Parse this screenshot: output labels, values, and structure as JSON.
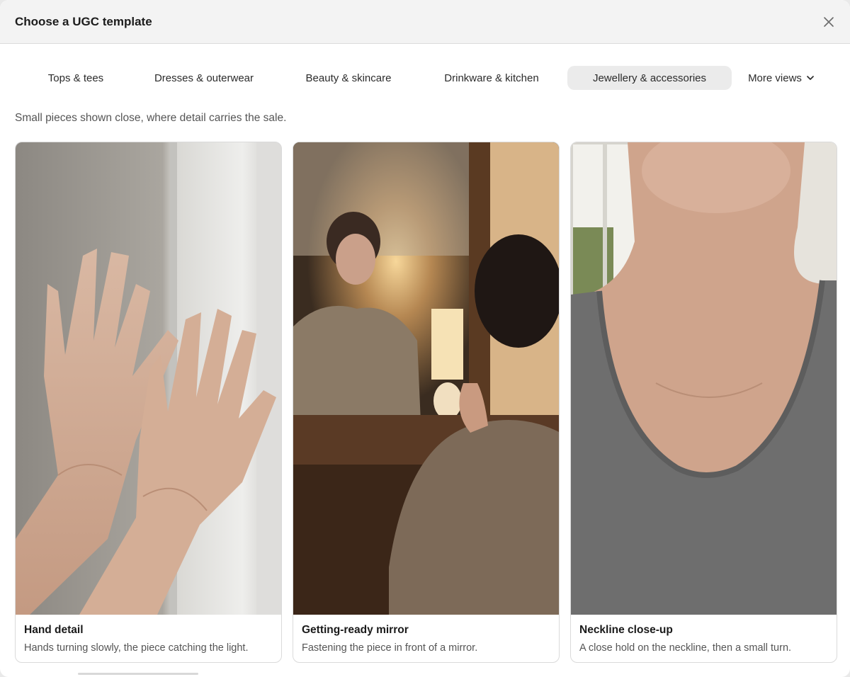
{
  "dialog": {
    "title": "Choose a UGC template",
    "close_icon": "close-icon"
  },
  "tabs": [
    {
      "label": "Tops & tees",
      "active": false
    },
    {
      "label": "Dresses & outerwear",
      "active": false
    },
    {
      "label": "Beauty & skincare",
      "active": false
    },
    {
      "label": "Drinkware & kitchen",
      "active": false
    },
    {
      "label": "Jewellery & accessories",
      "active": true
    }
  ],
  "more_views": {
    "label": "More views",
    "icon": "chevron-down-icon"
  },
  "category_description": "Small pieces shown close, where detail carries the sale.",
  "templates": [
    {
      "title": "Hand detail",
      "description": "Hands turning slowly, the piece catching the light."
    },
    {
      "title": "Getting-ready mirror",
      "description": "Fastening the piece in front of a mirror."
    },
    {
      "title": "Neckline close-up",
      "description": "A close hold on the neckline, then a small turn."
    }
  ],
  "colors": {
    "active_tab_bg": "#ebebeb",
    "header_bg": "#f3f3f3"
  }
}
